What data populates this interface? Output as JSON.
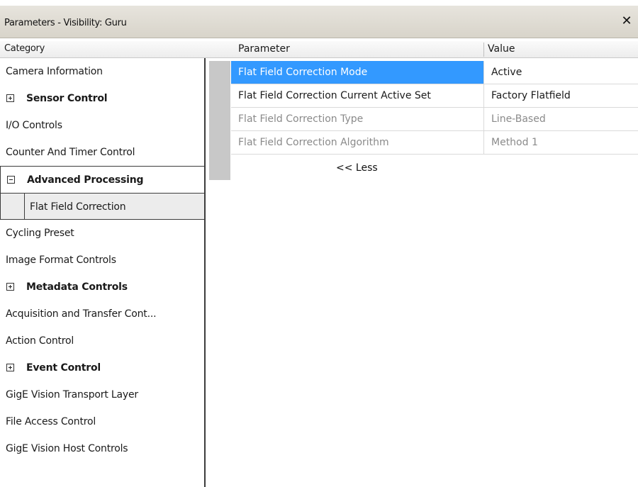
{
  "window": {
    "title": "Parameters - Visibility: Guru",
    "close_glyph": "✕"
  },
  "category_panel": {
    "header": "Category",
    "items": [
      {
        "label": "Camera Information",
        "kind": "item"
      },
      {
        "label": "Sensor Control",
        "kind": "group",
        "state": "collapsed"
      },
      {
        "label": "I/O Controls",
        "kind": "item"
      },
      {
        "label": "Counter And Timer Control",
        "kind": "item"
      },
      {
        "label": "Advanced Processing",
        "kind": "group",
        "state": "expanded"
      },
      {
        "label": "Flat Field Correction",
        "kind": "child",
        "selected": true
      },
      {
        "label": "Cycling Preset",
        "kind": "item"
      },
      {
        "label": "Image Format Controls",
        "kind": "item"
      },
      {
        "label": "Metadata Controls",
        "kind": "group",
        "state": "collapsed"
      },
      {
        "label": "Acquisition and Transfer Cont...",
        "kind": "item"
      },
      {
        "label": "Action Control",
        "kind": "item"
      },
      {
        "label": "Event Control",
        "kind": "group",
        "state": "collapsed"
      },
      {
        "label": "GigE Vision Transport Layer",
        "kind": "item"
      },
      {
        "label": "File Access Control",
        "kind": "item"
      },
      {
        "label": "GigE Vision Host Controls",
        "kind": "item"
      }
    ]
  },
  "parameter_panel": {
    "columns": {
      "parameter": "Parameter",
      "value": "Value"
    },
    "rows": [
      {
        "name": "Flat Field Correction Mode",
        "value": "Active",
        "selected": true,
        "enabled": true
      },
      {
        "name": "Flat Field Correction Current Active Set",
        "value": "Factory Flatfield",
        "selected": false,
        "enabled": true
      },
      {
        "name": "Flat Field Correction Type",
        "value": "Line-Based",
        "selected": false,
        "enabled": false
      },
      {
        "name": "Flat Field Correction Algorithm",
        "value": "Method 1",
        "selected": false,
        "enabled": false
      }
    ],
    "less_link": "<< Less"
  },
  "colors": {
    "selection": "#3399ff",
    "disabled_text": "#8a8a8a",
    "titlebar": "#dedad1"
  }
}
